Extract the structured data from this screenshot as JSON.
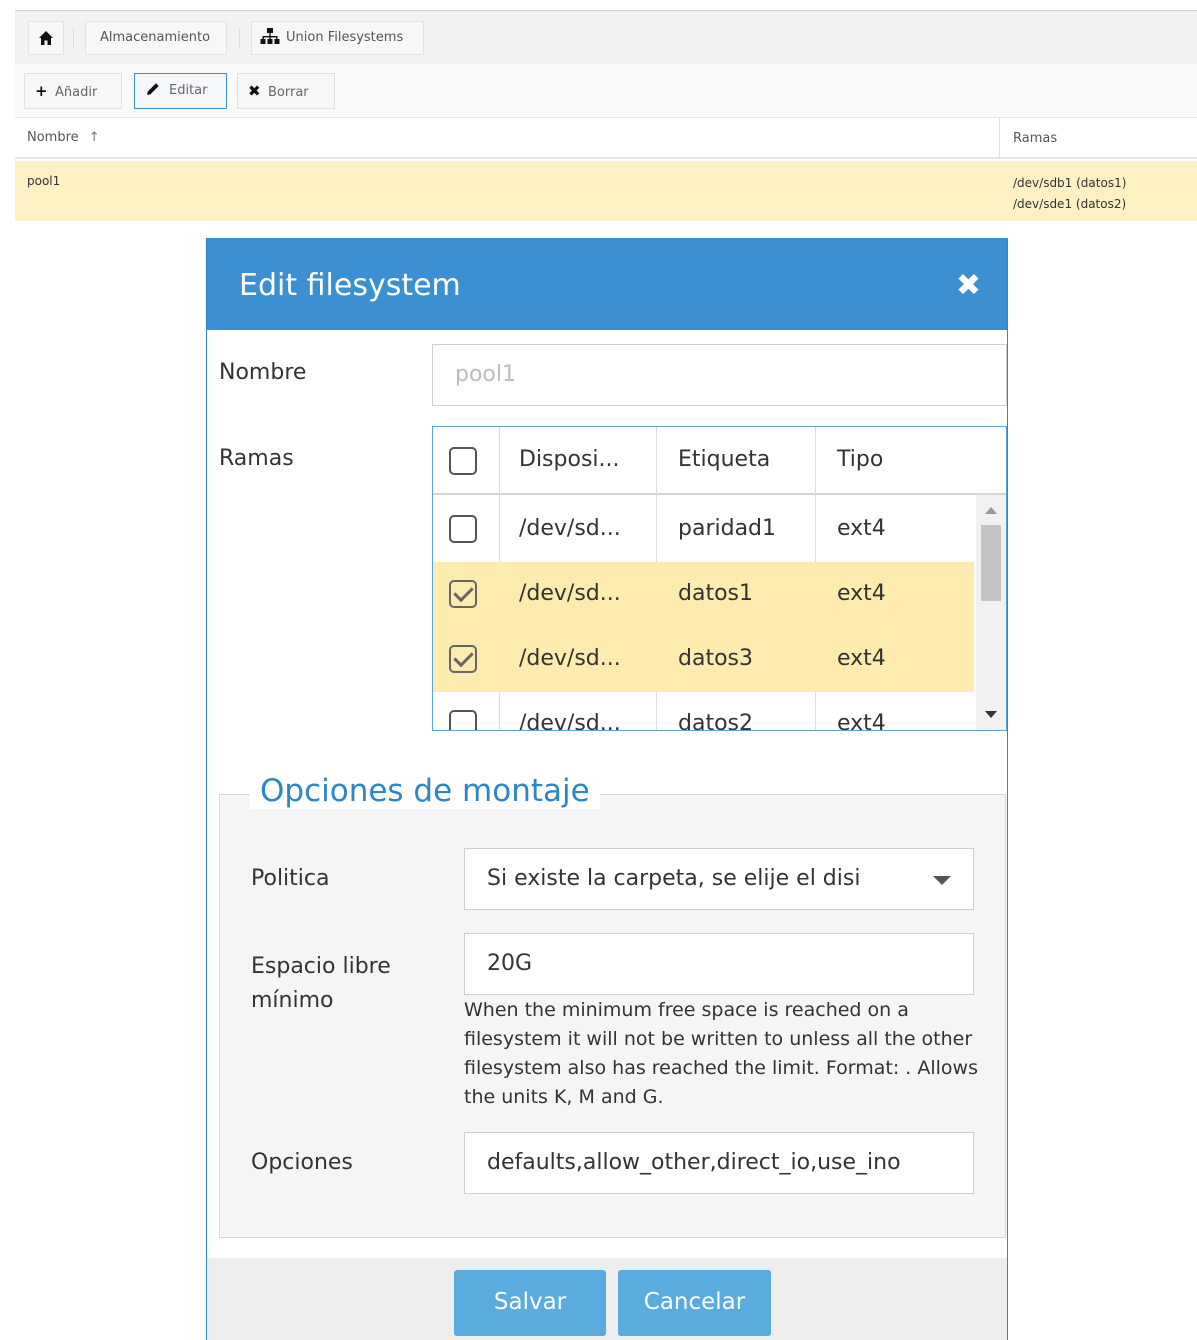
{
  "breadcrumb": {
    "home_icon": "home-icon",
    "items": [
      "Almacenamiento",
      "Union Filesystems"
    ],
    "union_icon": "sitemap-icon"
  },
  "toolbar": {
    "add_label": "Añadir",
    "edit_label": "Editar",
    "delete_label": "Borrar"
  },
  "grid": {
    "columns": [
      "Nombre",
      "Ramas"
    ],
    "sort_indicator": "↑",
    "rows": [
      {
        "name": "pool1",
        "ramas": [
          "/dev/sdb1 (datos1)",
          "/dev/sde1 (datos2)"
        ]
      }
    ]
  },
  "dialog": {
    "title": "Edit filesystem",
    "close_glyph": "✖",
    "name_label": "Nombre",
    "name_value": "pool1",
    "branches_label": "Ramas",
    "branches": {
      "columns": [
        "Disposi...",
        "Etiqueta",
        "Tipo"
      ],
      "rows": [
        {
          "device": "/dev/sd...",
          "label": "paridad1",
          "type": "ext4",
          "checked": false
        },
        {
          "device": "/dev/sd...",
          "label": "datos1",
          "type": "ext4",
          "checked": true
        },
        {
          "device": "/dev/sd...",
          "label": "datos3",
          "type": "ext4",
          "checked": true
        },
        {
          "device": "/dev/sd...",
          "label": "datos2",
          "type": "ext4",
          "checked": false
        }
      ]
    },
    "mount_options": {
      "legend": "Opciones de montaje",
      "policy_label": "Politica",
      "policy_value": "Si existe la carpeta, se elije el disi",
      "minfree_label": "Espacio libre mínimo",
      "minfree_value": "20G",
      "minfree_hint": "When the minimum free space is reached on a filesystem it will not be written to unless all the other filesystem also has reached the limit. Format: . Allows the units K, M and G.",
      "options_label": "Opciones",
      "options_value": "defaults,allow_other,direct_io,use_ino"
    },
    "save_label": "Salvar",
    "cancel_label": "Cancelar"
  },
  "colors": {
    "accent": "#3c8fd1",
    "selected_row": "#fdf0c3",
    "button": "#5aacdf"
  }
}
